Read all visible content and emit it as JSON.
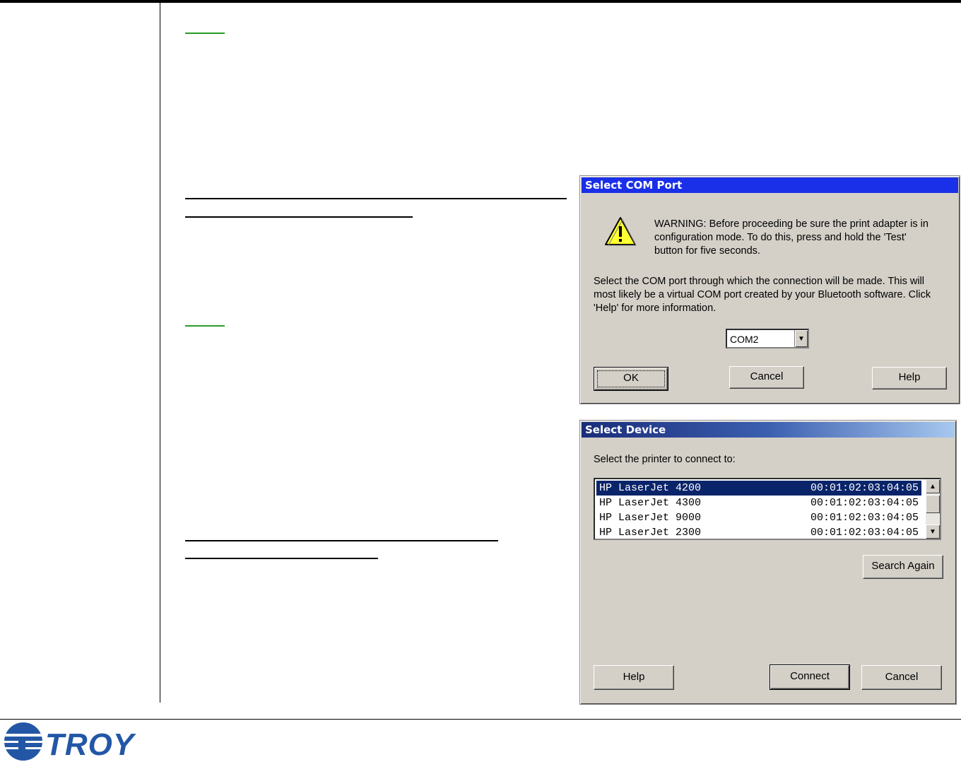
{
  "dialog_com": {
    "title": "Select COM Port",
    "warning": "WARNING:  Before proceeding be sure the print adapter is in configuration mode.  To do this, press and hold the 'Test' button for five seconds.",
    "warning_line1": "WARNING:  Before proceeding be sure the print adapter is in",
    "warning_line2": "configuration mode.  To do this, press and hold the 'Test'",
    "warning_line3": "button for five seconds.",
    "instr_line1": "Select the COM port through which the connection will be made.  This will",
    "instr_line2": "most likely be a virtual COM port created by your Bluetooth software.  Click",
    "instr_line3": "'Help' for more information.",
    "port_value": "COM2",
    "ok_label": "OK",
    "cancel_label": "Cancel",
    "help_label": "Help"
  },
  "dialog_device": {
    "title": "Select Device",
    "prompt": "Select the printer to connect to:",
    "devices": [
      {
        "name": "HP LaserJet 4200",
        "address": "00:01:02:03:04:05",
        "selected": true
      },
      {
        "name": "HP LaserJet 4300",
        "address": "00:01:02:03:04:05",
        "selected": false
      },
      {
        "name": "HP LaserJet 9000",
        "address": "00:01:02:03:04:05",
        "selected": false
      },
      {
        "name": "HP LaserJet 2300",
        "address": "00:01:02:03:04:05",
        "selected": false
      }
    ],
    "search_again_label": "Search Again",
    "help_label": "Help",
    "connect_label": "Connect",
    "cancel_label": "Cancel"
  },
  "footer": {
    "logo_text": "TROY",
    "logo_color": "#2357a6"
  },
  "colors": {
    "titlebar_active": "#1a2fe8",
    "selection": "#0a246a",
    "note_underline": "#2a9a2a"
  }
}
